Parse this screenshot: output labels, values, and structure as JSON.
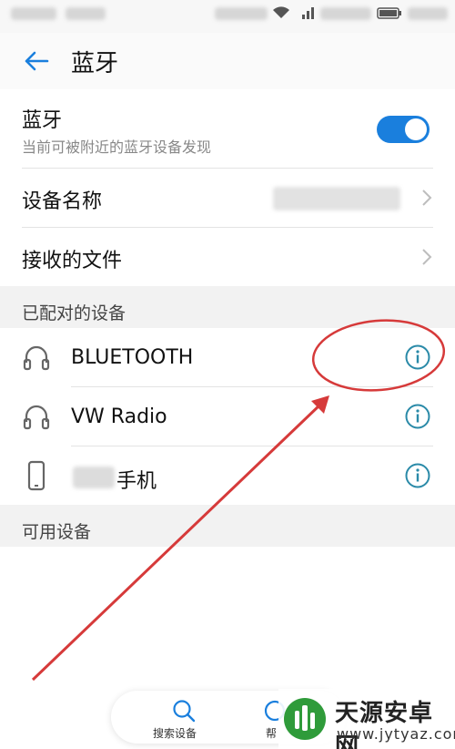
{
  "header": {
    "title": "蓝牙"
  },
  "bluetooth": {
    "title": "蓝牙",
    "subtitle": "当前可被附近的蓝牙设备发现",
    "enabled": true
  },
  "device_name": {
    "label": "设备名称"
  },
  "received_files": {
    "label": "接收的文件"
  },
  "paired_section": {
    "label": "已配对的设备"
  },
  "paired_devices": [
    {
      "name": "BLUETOOTH",
      "icon": "headphones-icon"
    },
    {
      "name": "VW Radio",
      "icon": "headphones-icon"
    },
    {
      "name": "手机",
      "icon": "phone-icon"
    }
  ],
  "available_section": {
    "label": "可用设备"
  },
  "bottom_bar": {
    "search_label": "搜索设备",
    "help_label": "帮"
  },
  "watermark": {
    "title": "天源安卓网",
    "url": "www.jytyaz.com"
  },
  "colors": {
    "accent": "#1a7fdd",
    "icon_teal": "#2a8aa8",
    "annotation_red": "#d63a3a"
  }
}
